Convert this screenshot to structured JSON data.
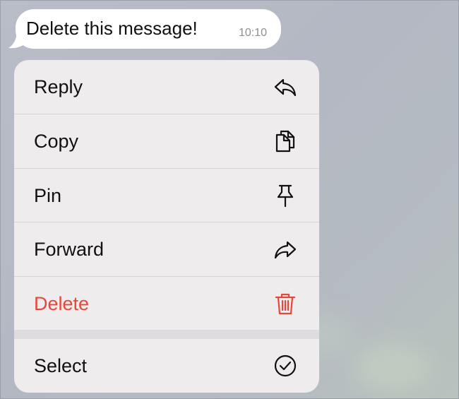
{
  "message": {
    "text": "Delete this message!",
    "time": "10:10"
  },
  "menu": {
    "items": [
      {
        "label": "Reply",
        "icon": "reply-icon"
      },
      {
        "label": "Copy",
        "icon": "copy-icon"
      },
      {
        "label": "Pin",
        "icon": "pin-icon"
      },
      {
        "label": "Forward",
        "icon": "forward-icon"
      },
      {
        "label": "Delete",
        "icon": "trash-icon",
        "color": "#e5483a"
      }
    ],
    "secondary": [
      {
        "label": "Select",
        "icon": "check-circle-icon"
      }
    ]
  },
  "colors": {
    "destructive": "#e5483a",
    "menu_background": "#efeced",
    "bubble_background": "#ffffff"
  }
}
